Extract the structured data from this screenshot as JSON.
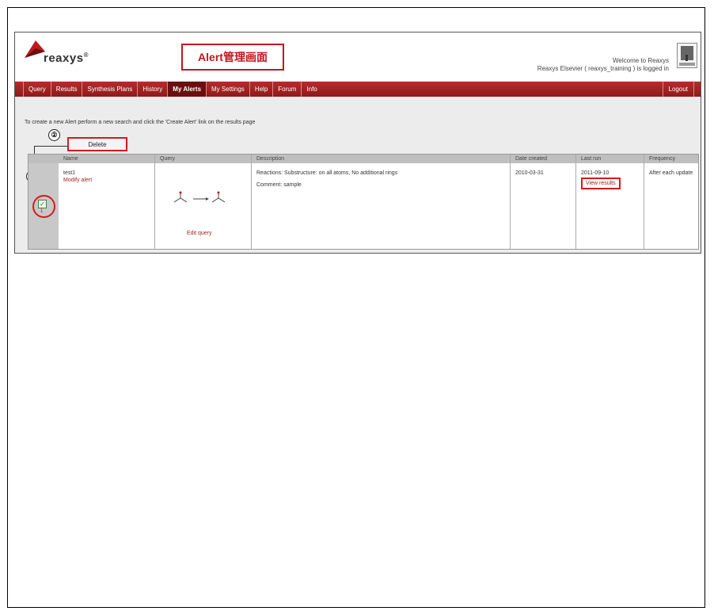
{
  "header": {
    "logo_text": "reaxys",
    "logo_mark": "®",
    "callout": "Alert管理画面",
    "welcome_line1": "Welcome to Reaxys",
    "welcome_line2": "Reaxys Elsevier ( reaxys_training ) is logged in"
  },
  "nav": {
    "items": [
      "Query",
      "Results",
      "Synthesis Plans",
      "History",
      "My Alerts",
      "My Settings",
      "Help",
      "Forum",
      "Info"
    ],
    "active": "My Alerts",
    "logout": "Logout"
  },
  "instruction": "To create a new Alert perform a new search and click the 'Create Alert' link on the results page",
  "badges": {
    "one": "①",
    "two": "②"
  },
  "toolbar": {
    "delete_label": "Delete"
  },
  "table": {
    "headers": {
      "name": "Name",
      "query": "Query",
      "description": "Description",
      "date_created": "Date created",
      "last_run": "Last run",
      "frequency": "Frequency"
    },
    "rows": [
      {
        "index": "1",
        "checked": true,
        "name": "test1",
        "modify": "Modify alert",
        "edit_query": "Edit query",
        "description": "Reactions: Substructure: on all atoms, No additional rings",
        "comment": "Comment: sample",
        "date_created": "2010-03-31",
        "last_run": "2011-09-10",
        "view_results": "View results",
        "frequency": "After each update"
      }
    ]
  },
  "colors": {
    "accent": "#c0181f",
    "nav": "#9e2020",
    "link": "#a02323"
  }
}
